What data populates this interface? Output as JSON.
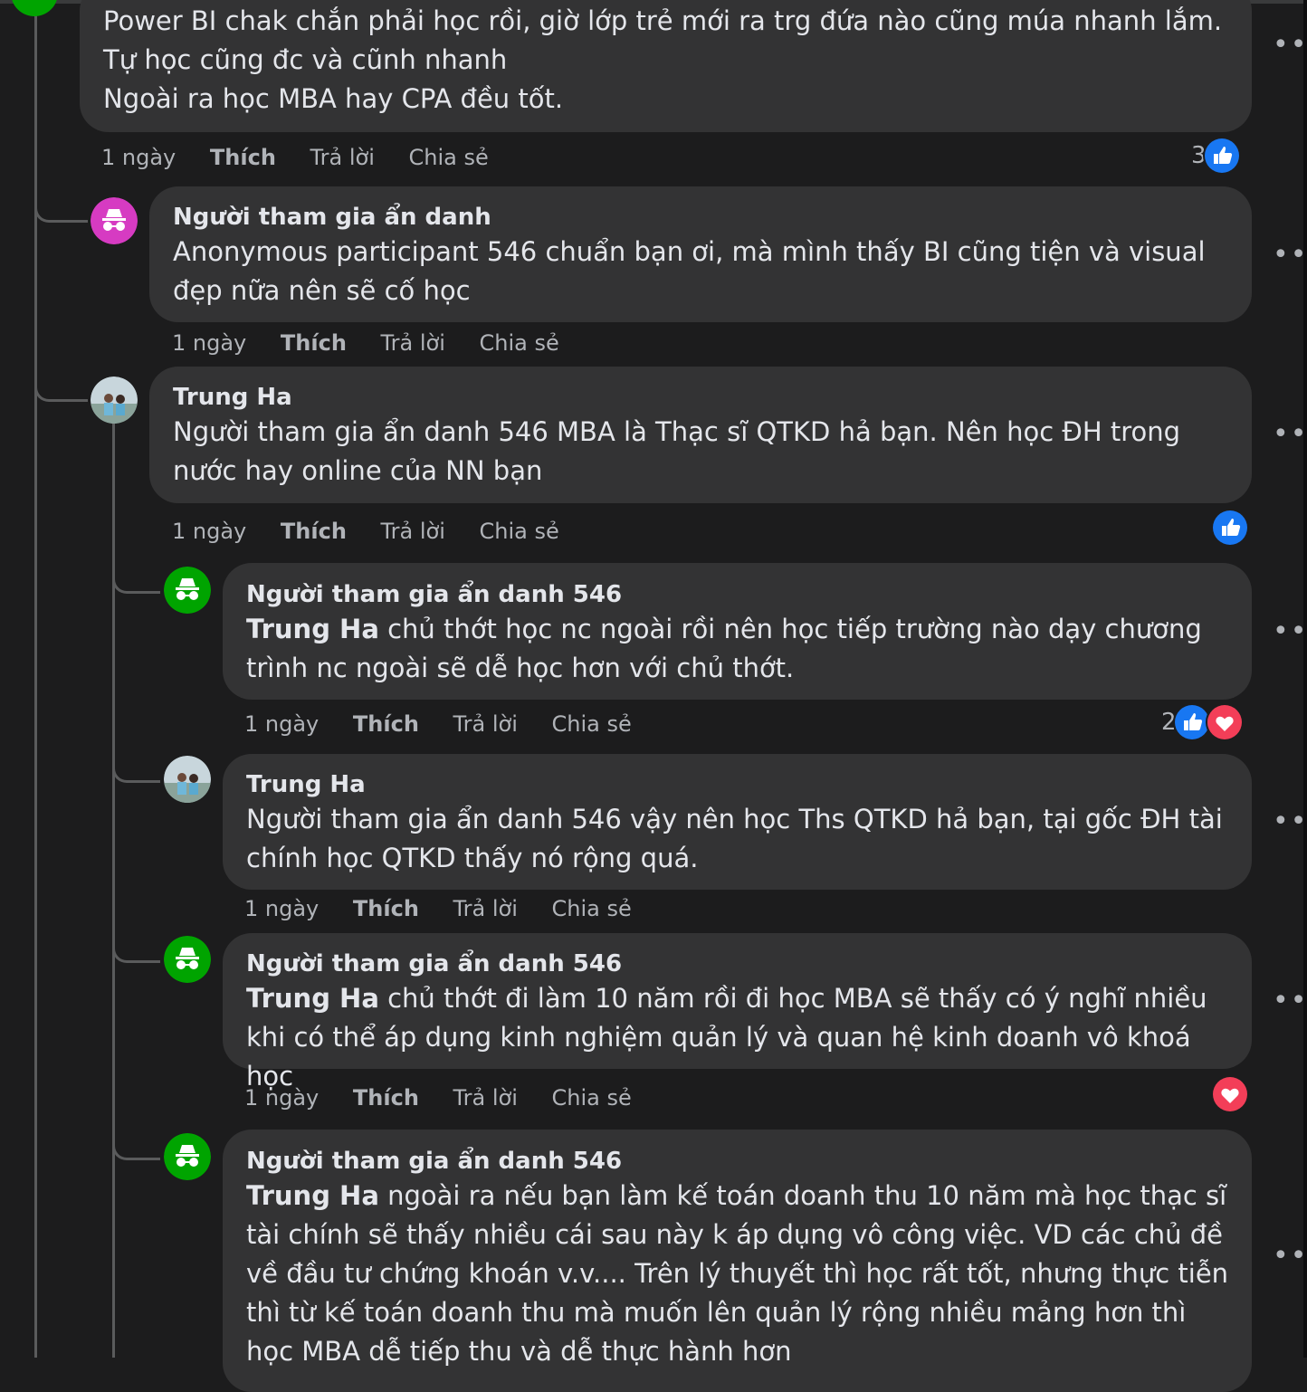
{
  "comments": [
    {
      "text_lines": [
        "Power BI chak chắn phải học rồi, giờ lớp trẻ mới ra trg đứa nào cũng múa nhanh lắm. Tự học cũng đc và cũnh nhanh",
        "Ngoài ra học MBA hay CPA đều tốt."
      ],
      "time": "1 ngày",
      "like": "Thích",
      "reply": "Trả lời",
      "share": "Chia sẻ",
      "reaction_count": "3",
      "reactions": [
        "like"
      ]
    },
    {
      "author": "Người tham gia ẩn danh",
      "text": "Anonymous participant 546 chuẩn bạn ơi, mà mình thấy BI cũng tiện và visual đẹp nữa nên sẽ cố học",
      "time": "1 ngày",
      "like": "Thích",
      "reply": "Trả lời",
      "share": "Chia sẻ"
    },
    {
      "author": "Trung Ha",
      "text": "Người tham gia ẩn danh 546 MBA là Thạc sĩ QTKD hả bạn. Nên học ĐH trong nước hay online của NN bạn",
      "time": "1 ngày",
      "like": "Thích",
      "reply": "Trả lời",
      "share": "Chia sẻ",
      "reactions": [
        "like"
      ]
    },
    {
      "author": "Người tham gia ẩn danh 546",
      "mention": "Trung Ha",
      "text": " chủ thớt học nc ngoài rồi nên học tiếp trường nào dạy chương trình nc ngoài sẽ dễ học hơn với chủ thớt.",
      "time": "1 ngày",
      "like": "Thích",
      "reply": "Trả lời",
      "share": "Chia sẻ",
      "reaction_count": "2",
      "reactions": [
        "like",
        "love"
      ]
    },
    {
      "author": "Trung Ha",
      "text": "Người tham gia ẩn danh 546 vậy nên học Ths QTKD hả bạn, tại gốc ĐH tài chính học QTKD thấy nó rộng quá.",
      "time": "1 ngày",
      "like": "Thích",
      "reply": "Trả lời",
      "share": "Chia sẻ"
    },
    {
      "author": "Người tham gia ẩn danh 546",
      "mention": "Trung Ha",
      "text": " chủ thớt đi làm 10 năm rồi đi học MBA sẽ thấy có ý nghĩ nhiều khi có thể áp dụng kinh nghiệm quản lý và quan hệ kinh doanh vô khoá học",
      "time": "1 ngày",
      "like": "Thích",
      "reply": "Trả lời",
      "share": "Chia sẻ",
      "reactions": [
        "love"
      ]
    },
    {
      "author": "Người tham gia ẩn danh 546",
      "mention": "Trung Ha",
      "text": " ngoài ra nếu bạn làm kế toán doanh thu 10 năm mà học thạc sĩ tài chính sẽ thấy nhiều cái sau này k áp dụng vô công việc. VD các chủ đề về đầu tư chứng khoán v.v.... Trên lý thuyết thì học rất tốt, nhưng thực tiễn thì từ kế toán doanh thu mà muốn lên quản lý rộng nhiều mảng hơn thì học MBA dễ tiếp thu và dễ thực hành hơn"
    }
  ],
  "more_label": "•••",
  "colors": {
    "background": "#1c1c1d",
    "bubble": "#333334",
    "like_blue": "#1877f2",
    "love_red": "#f33e58",
    "anon_green": "#00a400",
    "anon_pink": "#d63bc2"
  }
}
